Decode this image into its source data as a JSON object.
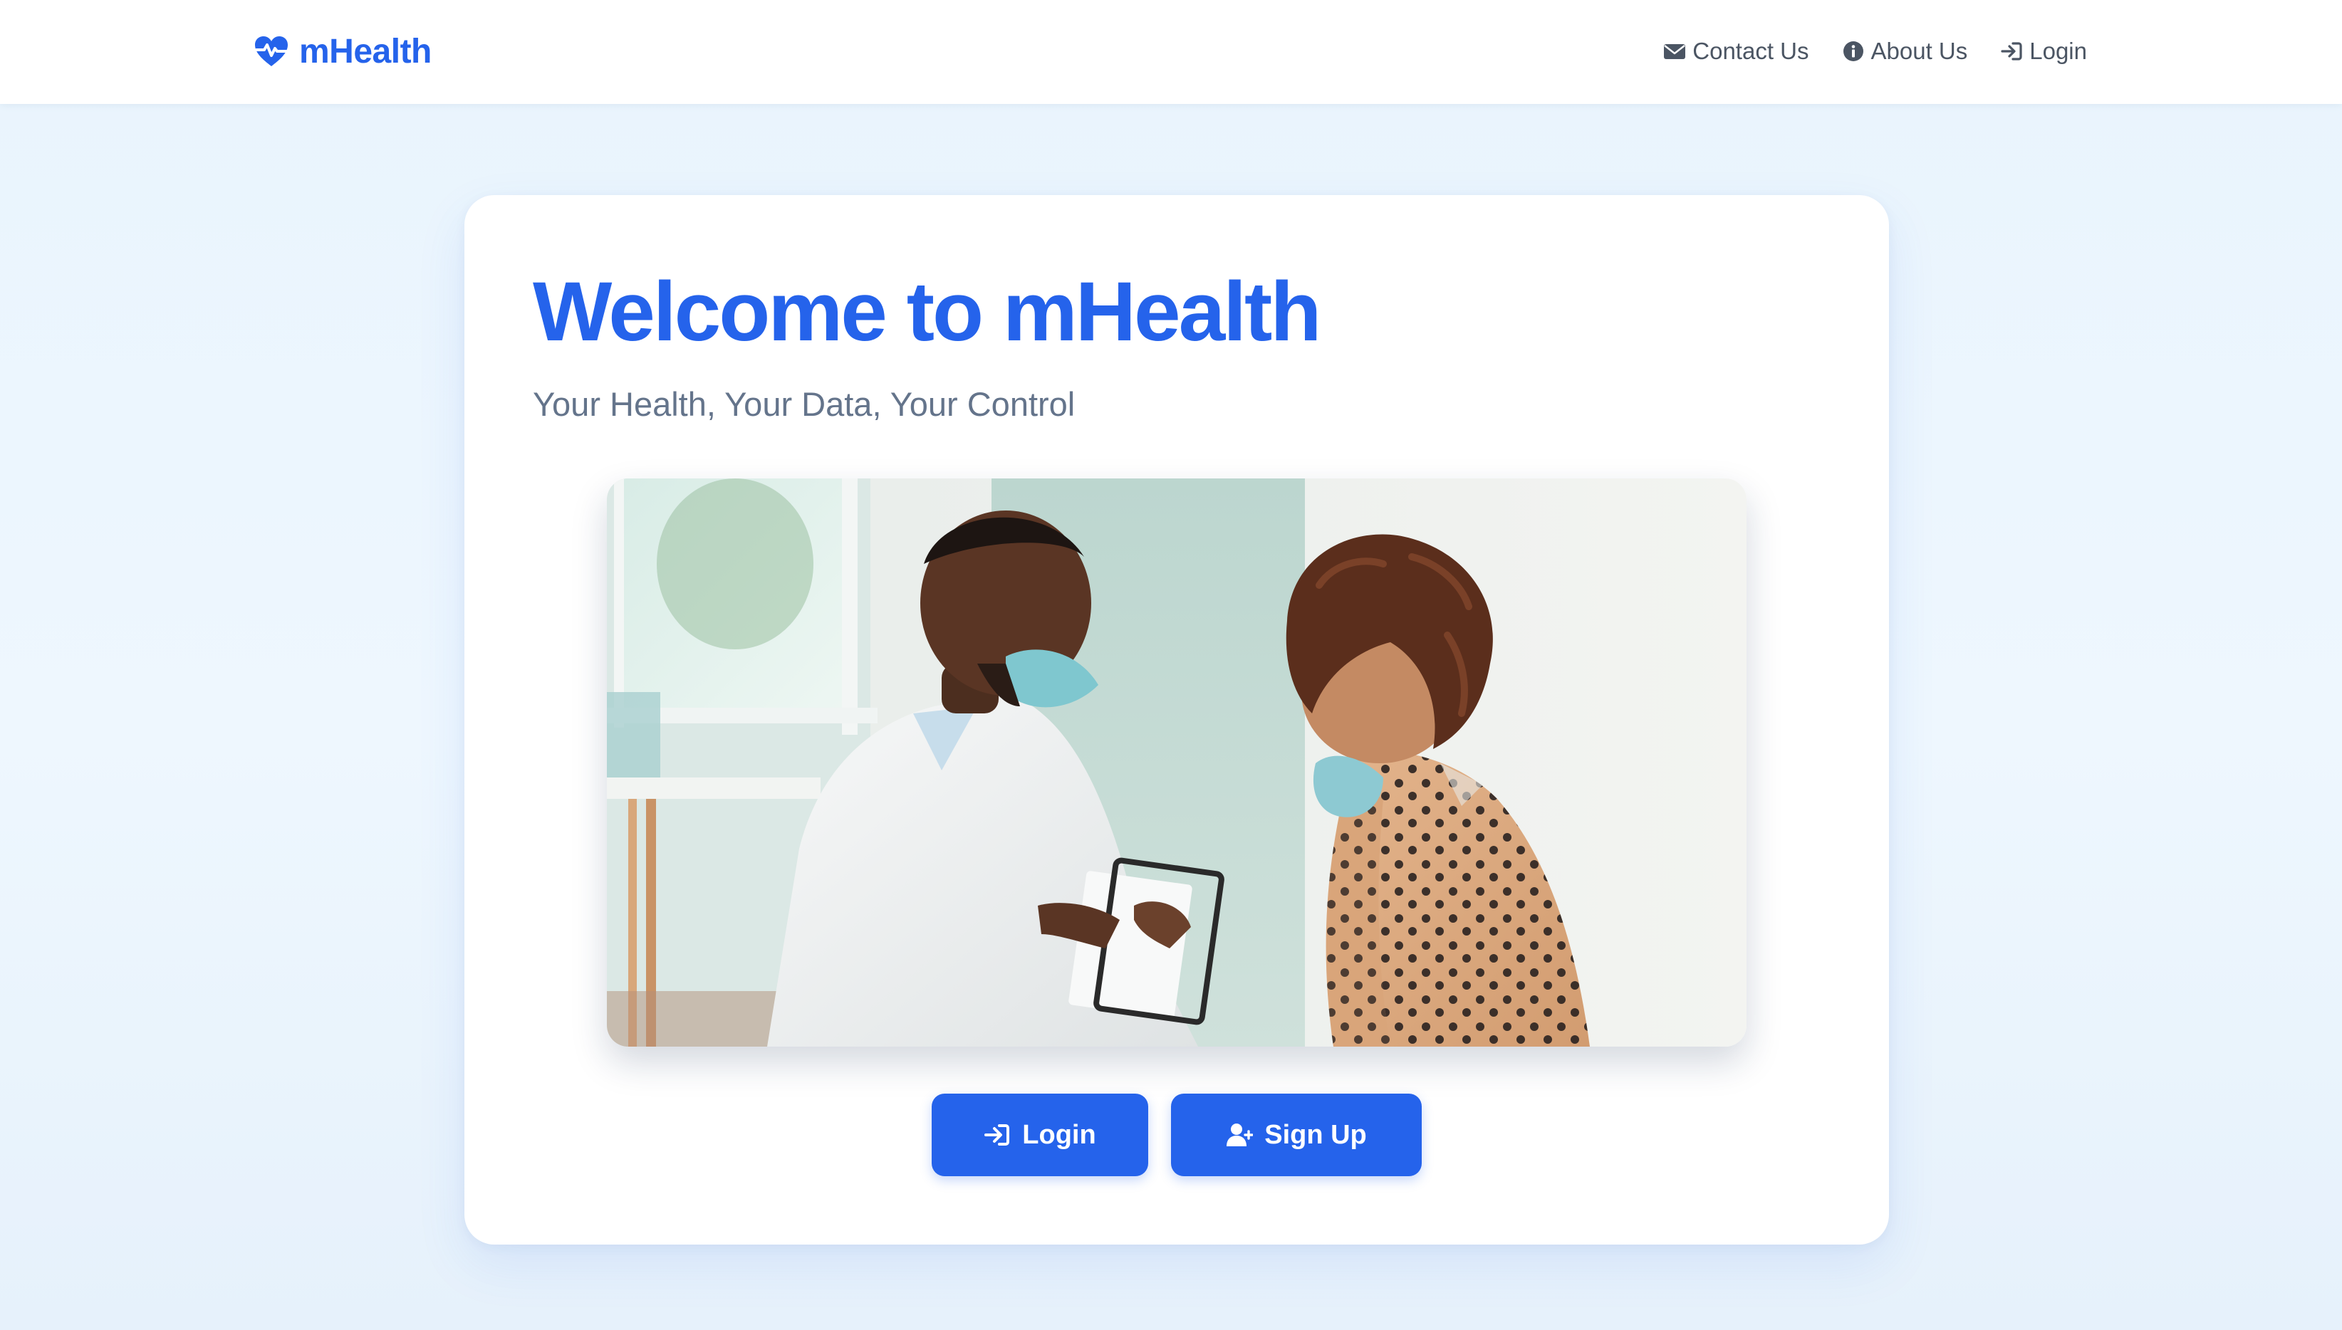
{
  "brand": {
    "name": "mHealth",
    "icon": "heart-pulse-icon"
  },
  "nav": {
    "items": [
      {
        "label": "Contact Us",
        "icon": "envelope-icon"
      },
      {
        "label": "About Us",
        "icon": "info-circle-icon"
      },
      {
        "label": "Login",
        "icon": "sign-in-icon"
      }
    ]
  },
  "hero": {
    "title": "Welcome to mHealth",
    "subtitle": "Your Health, Your Data, Your Control",
    "image_alt": "Doctor in a white coat and face mask reviewing a clipboard with a masked patient"
  },
  "actions": {
    "login_label": "Login",
    "login_icon": "sign-in-icon",
    "signup_label": "Sign Up",
    "signup_icon": "user-plus-icon"
  },
  "colors": {
    "primary": "#2563eb",
    "nav_text": "#4b5563",
    "subtitle_text": "#64748b",
    "page_background": "#e9f4fd"
  }
}
